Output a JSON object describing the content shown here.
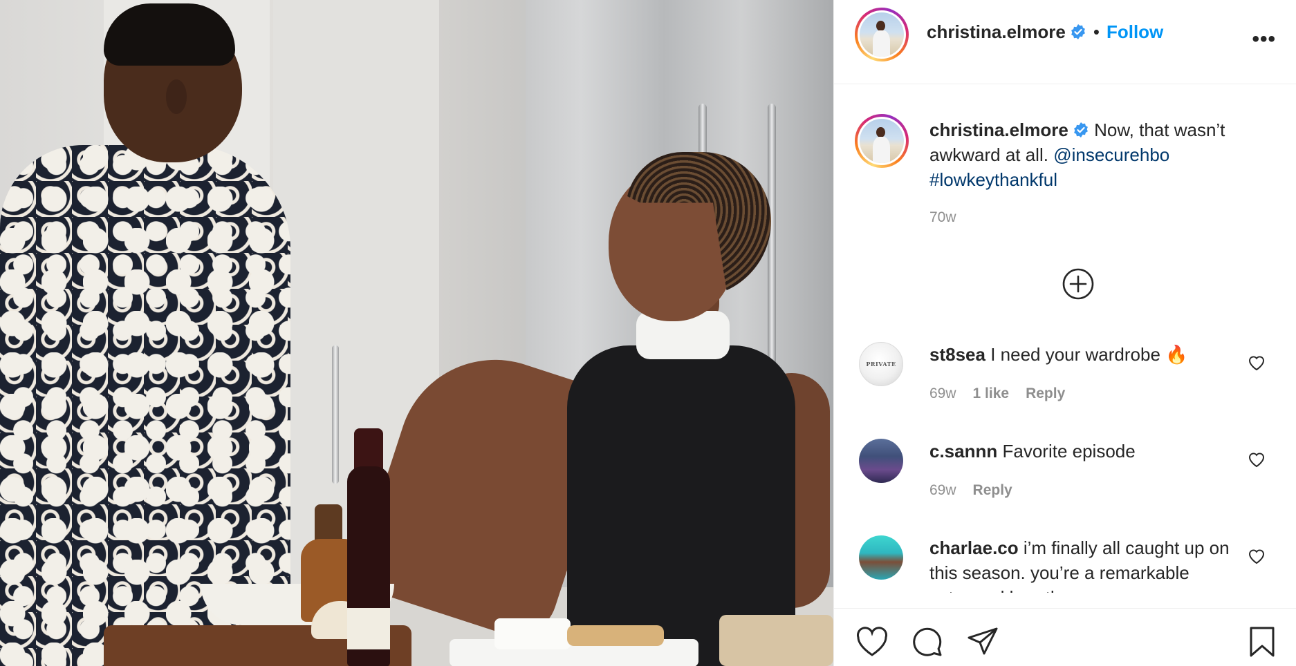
{
  "post": {
    "author": "christina.elmore",
    "follow_label": "Follow",
    "separator": "•",
    "more_label": "•••"
  },
  "caption": {
    "username": "christina.elmore",
    "text": "Now, that wasn’t awkward at all.",
    "mention": "@insecurehbo",
    "hashtag": "#lowkeythankful",
    "time": "70w"
  },
  "comments": [
    {
      "username": "st8sea",
      "text": "I need your wardrobe 🔥",
      "time": "69w",
      "likes": "1 like",
      "reply": "Reply",
      "avatar_text": "PRIVATE"
    },
    {
      "username": "c.sannn",
      "text": "Favorite episode",
      "time": "69w",
      "likes": "",
      "reply": "Reply"
    },
    {
      "username": "charlae.co",
      "text": "i’m finally all caught up on this season. you’re a remarkable actor and breath so",
      "time": "",
      "likes": "",
      "reply": ""
    }
  ],
  "icons": {
    "verified": "verified-badge-icon",
    "load_more": "plus-circle-icon",
    "like": "heart-icon",
    "comment": "comment-bubble-icon",
    "share": "paper-plane-icon",
    "save": "bookmark-icon"
  },
  "colors": {
    "link_blue": "#0095f6",
    "mention_blue": "#00376b",
    "muted_gray": "#8e8e8e",
    "text": "#262626"
  }
}
